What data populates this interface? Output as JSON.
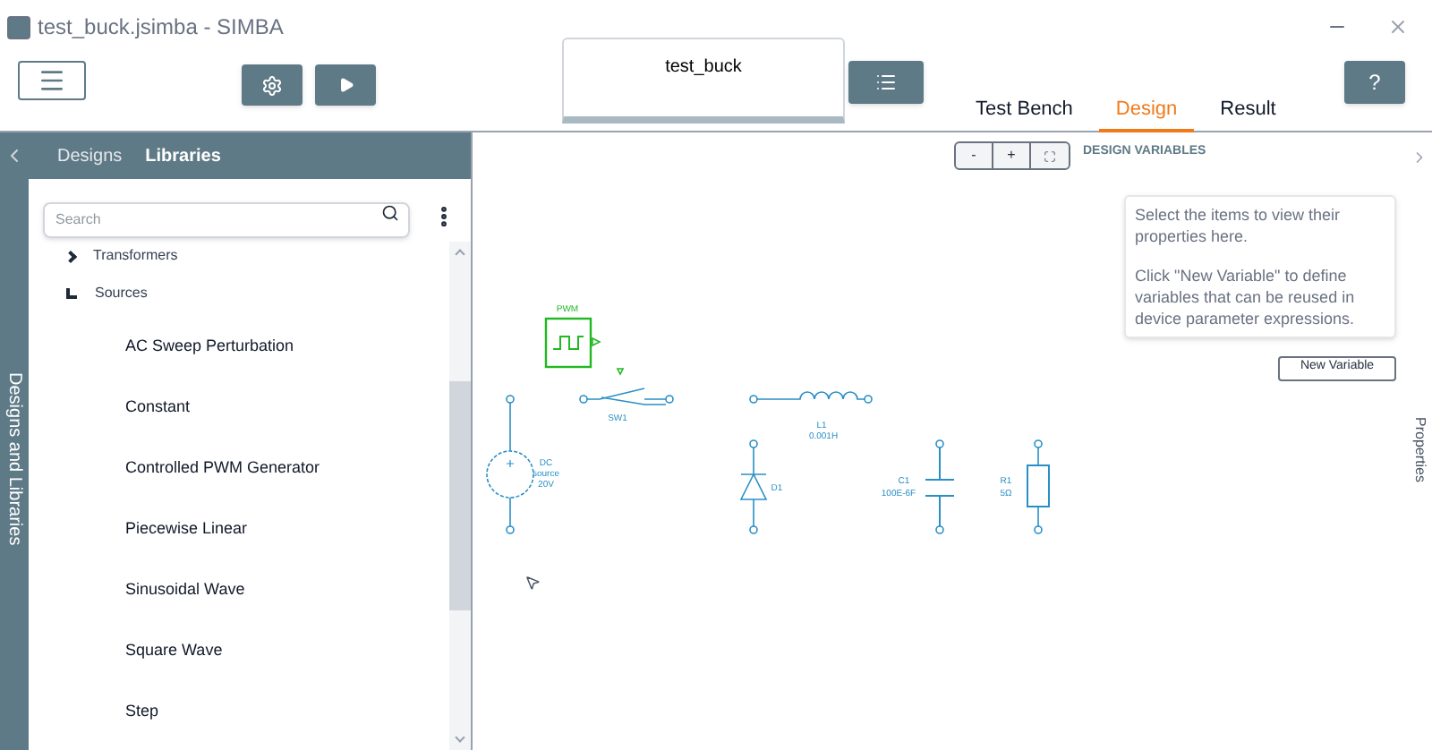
{
  "window": {
    "title": "test_buck.jsimba - SIMBA"
  },
  "document_tab": {
    "title": "test_buck"
  },
  "tabs": [
    {
      "label": "Test Bench",
      "selected": false
    },
    {
      "label": "Design",
      "selected": true
    },
    {
      "label": "Result",
      "selected": false
    }
  ],
  "left_panel": {
    "side_label": "Designs and Libraries",
    "tabs": [
      {
        "label": "Designs",
        "selected": false
      },
      {
        "label": "Libraries",
        "selected": true
      }
    ],
    "search": {
      "placeholder": "Search"
    },
    "tree": [
      {
        "label": "Transformers",
        "expanded": false
      },
      {
        "label": "Sources",
        "expanded": true,
        "children": [
          {
            "label": "AC Sweep Perturbation"
          },
          {
            "label": "Constant"
          },
          {
            "label": "Controlled PWM Generator"
          },
          {
            "label": "Piecewise Linear"
          },
          {
            "label": "Sinusoidal Wave"
          },
          {
            "label": "Square Wave"
          },
          {
            "label": "Step"
          }
        ]
      }
    ]
  },
  "help_button": "?",
  "zoom_controls": [
    "-",
    "+"
  ],
  "circuit": {
    "pwm": "PWM",
    "switch": "SW1",
    "source": [
      "DC",
      "source",
      "20V"
    ],
    "inductor": [
      "L1",
      "0.001H"
    ],
    "diode": "D1",
    "capacitor": [
      "C1",
      "100E-6F"
    ],
    "resistor": [
      "R1",
      "5Ω"
    ]
  },
  "right_panel": {
    "heading": "DESIGN VARIABLES",
    "hint": "Select the items to view their properties here.",
    "hint2": "Click \"New Variable\" to define variables that can be reused in device parameter expressions.",
    "button": "New Variable",
    "side_label": "Properties"
  }
}
